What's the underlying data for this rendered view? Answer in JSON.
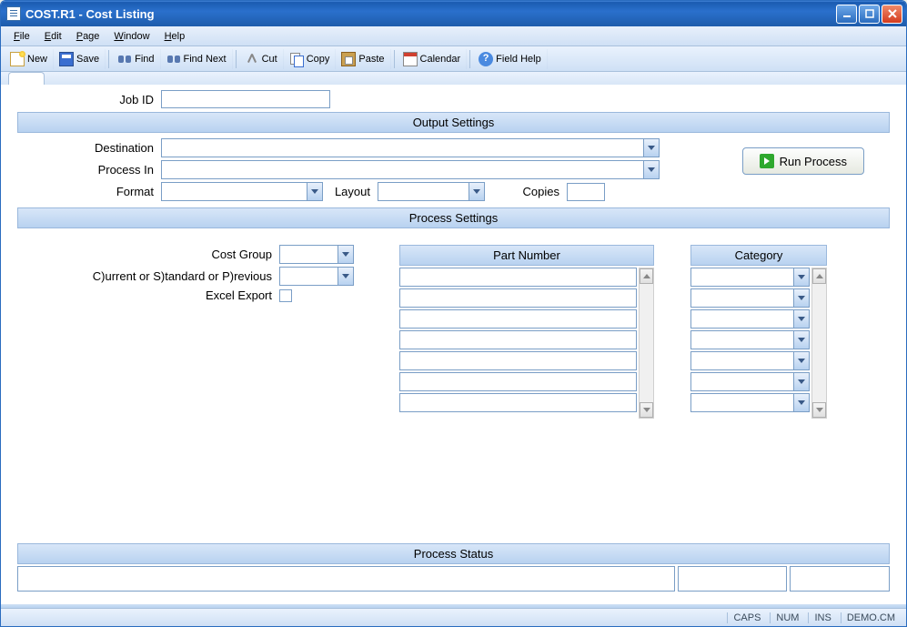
{
  "window": {
    "title": "COST.R1  - Cost Listing"
  },
  "menu": {
    "items": [
      "File",
      "Edit",
      "Page",
      "Window",
      "Help"
    ]
  },
  "toolbar": {
    "new": "New",
    "save": "Save",
    "find": "Find",
    "findnext": "Find Next",
    "cut": "Cut",
    "copy": "Copy",
    "paste": "Paste",
    "calendar": "Calendar",
    "fieldhelp": "Field Help"
  },
  "form": {
    "job_id_label": "Job ID",
    "job_id_value": "",
    "section_output": "Output Settings",
    "destination_label": "Destination",
    "destination_value": "",
    "process_in_label": "Process In",
    "process_in_value": "",
    "format_label": "Format",
    "format_value": "",
    "layout_label": "Layout",
    "layout_value": "",
    "copies_label": "Copies",
    "copies_value": "",
    "run_label": "Run Process",
    "section_process": "Process Settings",
    "cost_group_label": "Cost Group",
    "cost_group_value": "",
    "csp_label": "C)urrent or S)tandard or P)revious",
    "csp_value": "",
    "excel_label": "Excel Export",
    "excel_checked": false,
    "part_number_header": "Part Number",
    "part_numbers": [
      "",
      "",
      "",
      "",
      "",
      "",
      ""
    ],
    "category_header": "Category",
    "categories": [
      "",
      "",
      "",
      "",
      "",
      "",
      ""
    ],
    "section_status": "Process Status",
    "status_cells": [
      "",
      "",
      ""
    ]
  },
  "statusbar": {
    "caps": "CAPS",
    "num": "NUM",
    "ins": "INS",
    "db": "DEMO.CM"
  }
}
